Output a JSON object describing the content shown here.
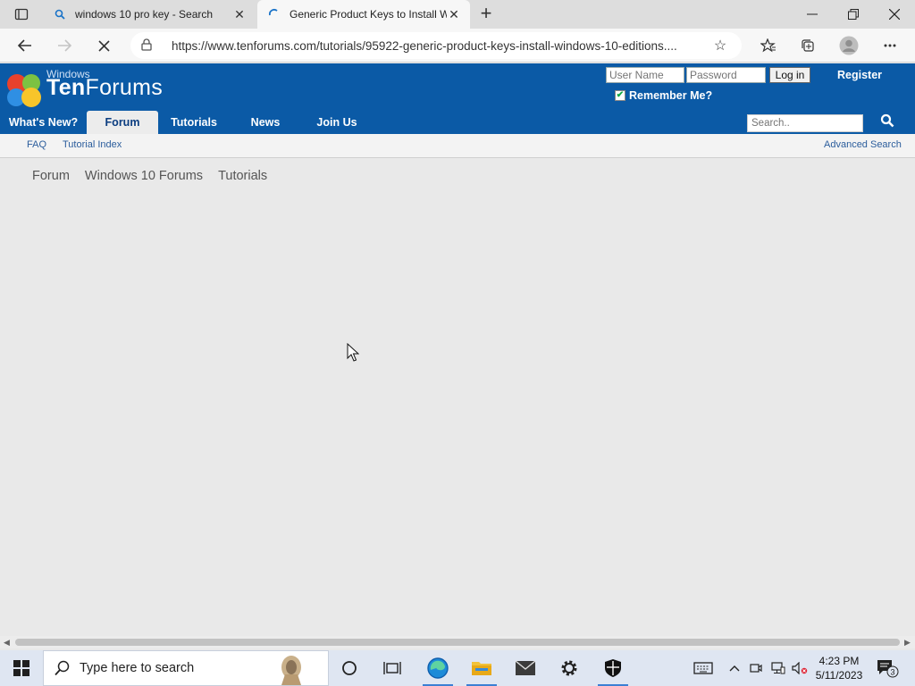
{
  "browser": {
    "tabs": [
      {
        "title": "windows 10 pro key - Search",
        "favicon": "search-icon"
      },
      {
        "title": "Generic Product Keys to Install W",
        "favicon": "loading-spinner-icon",
        "active": true
      }
    ],
    "url": "https://www.tenforums.com/tutorials/95922-generic-product-keys-install-windows-10-editions...."
  },
  "site": {
    "logo_small": "Windows",
    "logo_ten": "Ten",
    "logo_forums": "Forums",
    "login": {
      "username_placeholder": "User Name",
      "password_placeholder": "Password",
      "login_label": "Log in",
      "register_label": "Register",
      "remember_label": "Remember Me?",
      "remember_checked": true
    },
    "nav": [
      "What's New?",
      "Forum",
      "Tutorials",
      "News",
      "Join Us"
    ],
    "nav_active": "Forum",
    "search_placeholder": "Search..",
    "subnav": {
      "faq": "FAQ",
      "tutorial_index": "Tutorial Index",
      "advanced_search": "Advanced Search"
    },
    "breadcrumb": [
      "Forum",
      "Windows 10 Forums",
      "Tutorials"
    ]
  },
  "taskbar": {
    "search_placeholder": "Type here to search",
    "time": "4:23 PM",
    "date": "5/11/2023",
    "notification_count": "3"
  },
  "colors": {
    "site_header": "#0b5aa6",
    "taskbar": "#dfe6f2"
  }
}
